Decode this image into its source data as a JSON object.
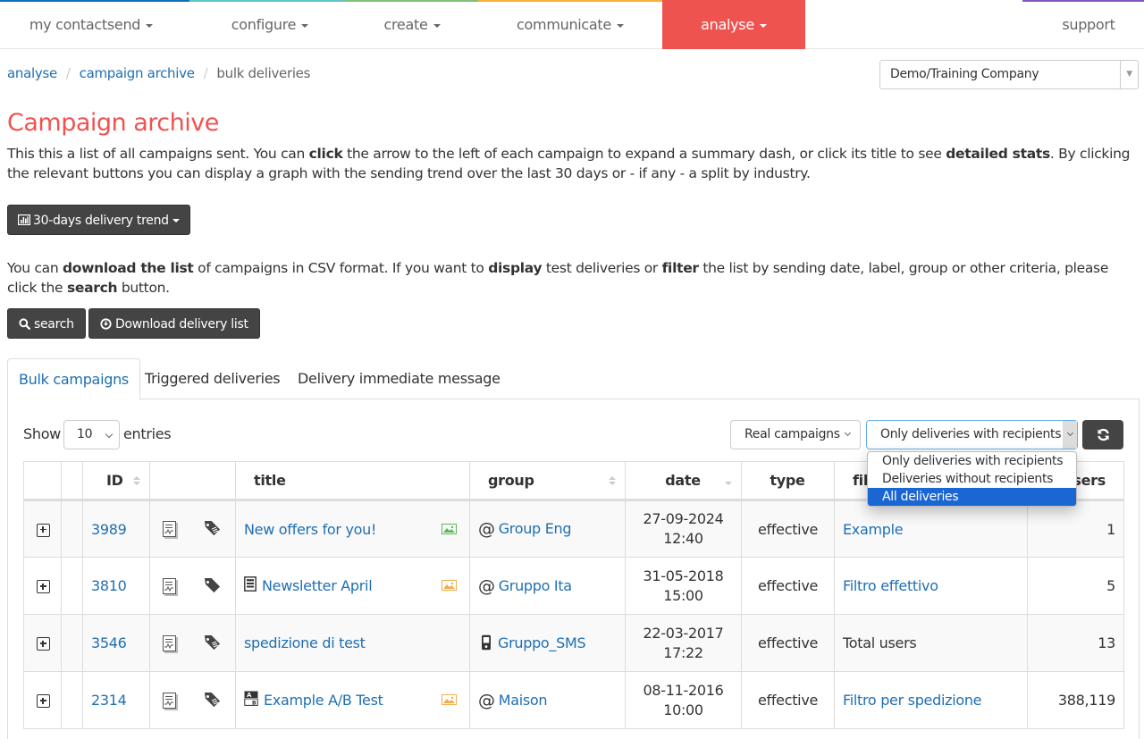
{
  "colors": {
    "accent": "#ef5350",
    "link": "#1f6fb2",
    "topbar": [
      "#0e6fb8",
      "#5ec3cd",
      "#7cc278",
      "#f6b135",
      "#ffffff",
      "#7e57c2"
    ]
  },
  "nav": {
    "items": [
      {
        "label": "my contactsend",
        "dropdown": true,
        "active": false
      },
      {
        "label": "configure",
        "dropdown": true,
        "active": false
      },
      {
        "label": "create",
        "dropdown": true,
        "active": false
      },
      {
        "label": "communicate",
        "dropdown": true,
        "active": false
      },
      {
        "label": "analyse",
        "dropdown": true,
        "active": true
      },
      {
        "label": "support",
        "dropdown": false,
        "active": false
      }
    ]
  },
  "breadcrumb": {
    "items": [
      "analyse",
      "campaign archive"
    ],
    "current": "bulk deliveries"
  },
  "company_select": {
    "value": "Demo/Training Company"
  },
  "page": {
    "title": "Campaign archive",
    "intro": {
      "t1": "This this a list of all campaigns sent. You can ",
      "b1": "click",
      "t2": " the arrow to the left of each campaign to expand a summary dash, or click its title to see ",
      "b2": "detailed stats",
      "t3": ". By clicking the relevant buttons you can display a graph with the sending trend over the last 30 days or - if any - a split by industry."
    },
    "trend_button": "30-days delivery trend",
    "download_text": {
      "t1": "You can ",
      "b1": "download the list",
      "t2": " of campaigns in CSV format. If you want to ",
      "b2": "display",
      "t3": " test deliveries or ",
      "b3": "filter",
      "t4": " the list by sending date, label, group or other criteria, please click the ",
      "b4": "search",
      "t5": " button."
    },
    "search_button": "search",
    "download_button": "Download delivery list"
  },
  "tabs": [
    {
      "label": "Bulk campaigns",
      "active": true
    },
    {
      "label": "Triggered deliveries",
      "active": false
    },
    {
      "label": "Delivery immediate message",
      "active": false
    }
  ],
  "table_controls": {
    "show_label": "Show",
    "entries_value": "10",
    "entries_label": "entries",
    "campaign_filter": "Real campaigns",
    "recipient_filter": "Only deliveries with recipients",
    "recipient_options": [
      {
        "label": "Only deliveries with recipients",
        "highlighted": false
      },
      {
        "label": "Deliveries without recipients",
        "highlighted": false
      },
      {
        "label": "All deliveries",
        "highlighted": true
      }
    ]
  },
  "table": {
    "headers": {
      "id": "ID",
      "title": "title",
      "group": "group",
      "date": "date",
      "type": "type",
      "filter": "filter",
      "users": "users"
    },
    "rows": [
      {
        "id": "3989",
        "title": "New offers for you!",
        "title_icon": "",
        "image_icon": "image-icon",
        "image_color": "#5cb85c",
        "group_icon": "at-icon",
        "group": "Group Eng",
        "date": "27-09-2024",
        "time": "12:40",
        "type": "effective",
        "filter": "Example",
        "filter_link": true,
        "users": "1",
        "tag_icon": "tags-icon"
      },
      {
        "id": "3810",
        "title": "Newsletter April",
        "title_icon": "newsletter-icon",
        "image_icon": "image-icon",
        "image_color": "#f0ad4e",
        "group_icon": "at-icon",
        "group": "Gruppo Ita",
        "date": "31-05-2018",
        "time": "15:00",
        "type": "effective",
        "filter": "Filtro effettivo",
        "filter_link": true,
        "users": "5",
        "tag_icon": "tag-icon"
      },
      {
        "id": "3546",
        "title": "spedizione di test",
        "title_icon": "",
        "image_icon": "",
        "image_color": "",
        "group_icon": "mobile-icon",
        "group": "Gruppo_SMS",
        "date": "22-03-2017",
        "time": "17:22",
        "type": "effective",
        "filter": "Total users",
        "filter_link": false,
        "users": "13",
        "tag_icon": "tags-icon"
      },
      {
        "id": "2314",
        "title": "Example A/B Test",
        "title_icon": "ab-test-icon",
        "image_icon": "image-icon",
        "image_color": "#f0ad4e",
        "group_icon": "at-icon",
        "group": "Maison",
        "date": "08-11-2016",
        "time": "10:00",
        "type": "effective",
        "filter": "Filtro per spedizione",
        "filter_link": true,
        "users": "388,119",
        "tag_icon": "tags-icon"
      }
    ]
  }
}
